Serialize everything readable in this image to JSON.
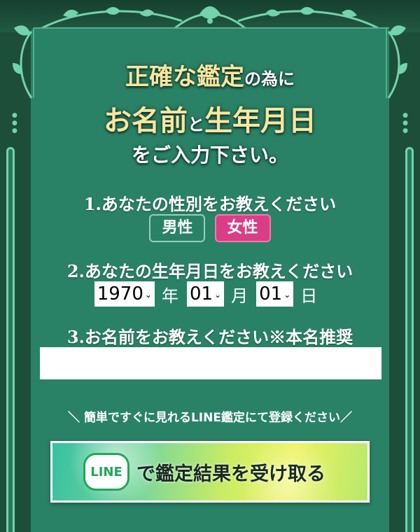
{
  "headline": {
    "line1_part1": "正確な鑑定",
    "line1_part2": "の為に",
    "line2_part1": "お名前",
    "line2_part2": "と",
    "line2_part3": "生年月日",
    "line3": "をご入力下さい。"
  },
  "gender": {
    "question": "1.あなたの性別をお教えください",
    "male_label": "男性",
    "female_label": "女性",
    "selected": "female"
  },
  "birthdate": {
    "question": "2.あなたの生年月日をお教えください",
    "year_value": "1970",
    "year_unit": "年",
    "month_value": "01",
    "month_unit": "月",
    "day_value": "01",
    "day_unit": "日"
  },
  "name": {
    "question": "3.お名前をお教えください※本名推奨",
    "value": "",
    "placeholder": ""
  },
  "line": {
    "note": "＼ 簡単ですぐに見れるLINE鑑定にて登録ください／",
    "logo_text": "LINE",
    "button_label": "で鑑定結果を受け取る"
  },
  "colors": {
    "panel": "#2a8266",
    "frame": "#1d4e3a",
    "accent_pink": "#d93d86",
    "gold_text": "#f6e7a0",
    "line_green": "#1fa858"
  }
}
